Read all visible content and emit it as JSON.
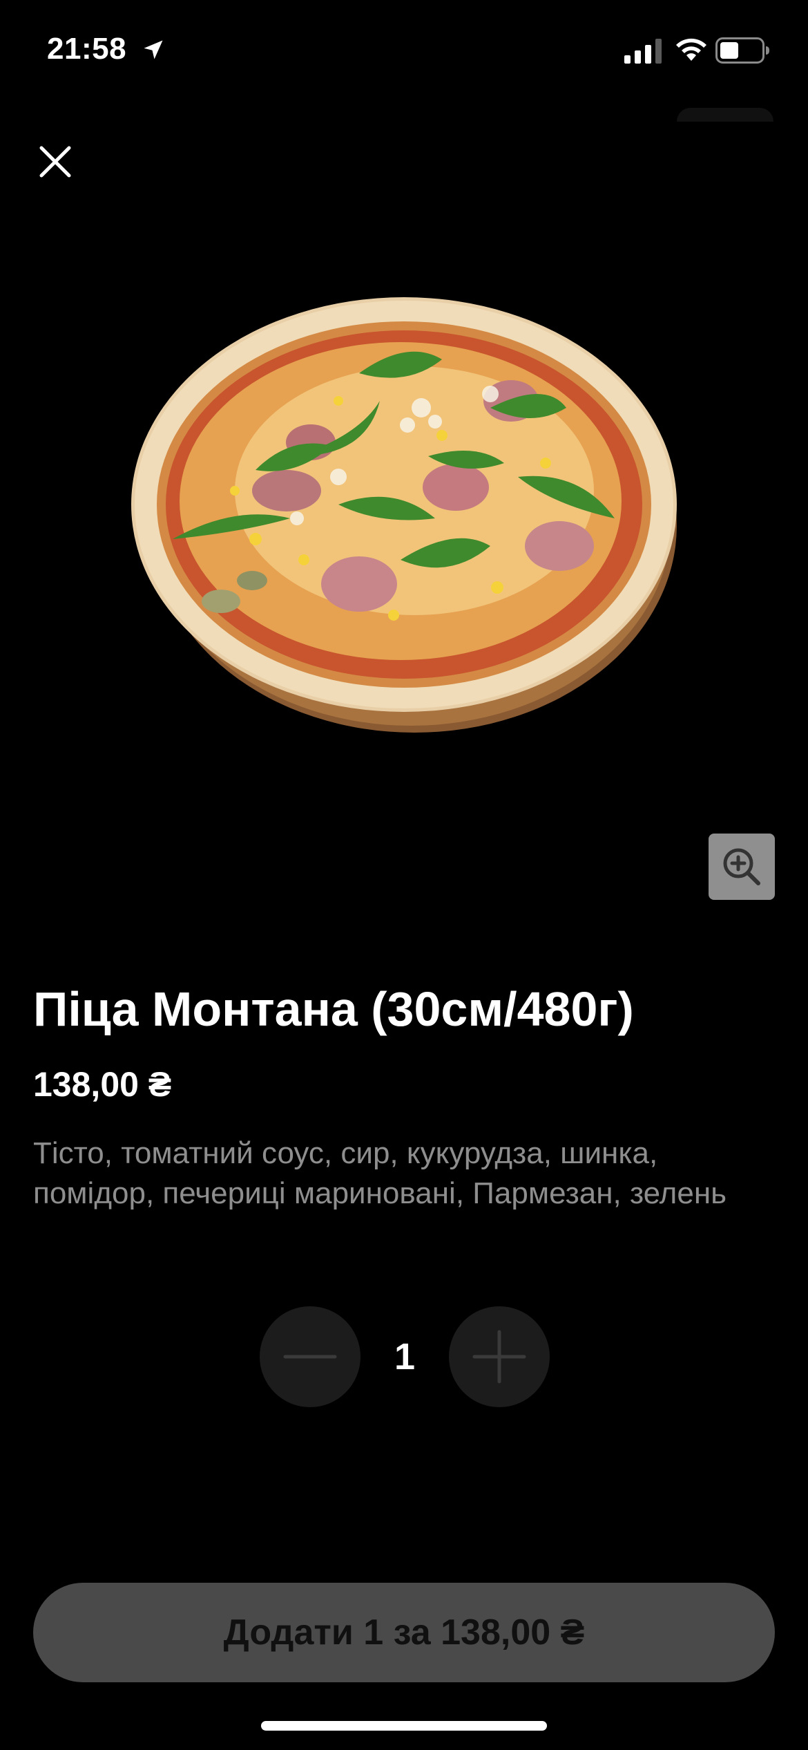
{
  "status_bar": {
    "time": "21:58",
    "icons": [
      "location-arrow-icon",
      "cellular-signal-icon",
      "wifi-icon",
      "battery-icon"
    ]
  },
  "header": {
    "close_icon": "close-icon"
  },
  "product": {
    "image": "pizza-image",
    "title": "Піца Монтана (30см/480г)",
    "price": "138,00 ₴",
    "description": "Тісто, томатний соус, сир, кукурудза, шинка, помідор, печериці мариновані, Пармезан, зелень"
  },
  "zoom": {
    "icon": "zoom-in-icon"
  },
  "quantity": {
    "value": "1",
    "minus_icon": "minus-icon",
    "plus_icon": "plus-icon"
  },
  "add_button": {
    "label": "Додати 1 за 138,00 ₴"
  },
  "colors": {
    "background": "#000000",
    "text_primary": "#ffffff",
    "text_secondary": "#8e8e8e",
    "stepper_bg": "#1c1c1c",
    "add_button_bg": "#4a4a4a",
    "zoom_button_bg": "#8f8f8f"
  }
}
